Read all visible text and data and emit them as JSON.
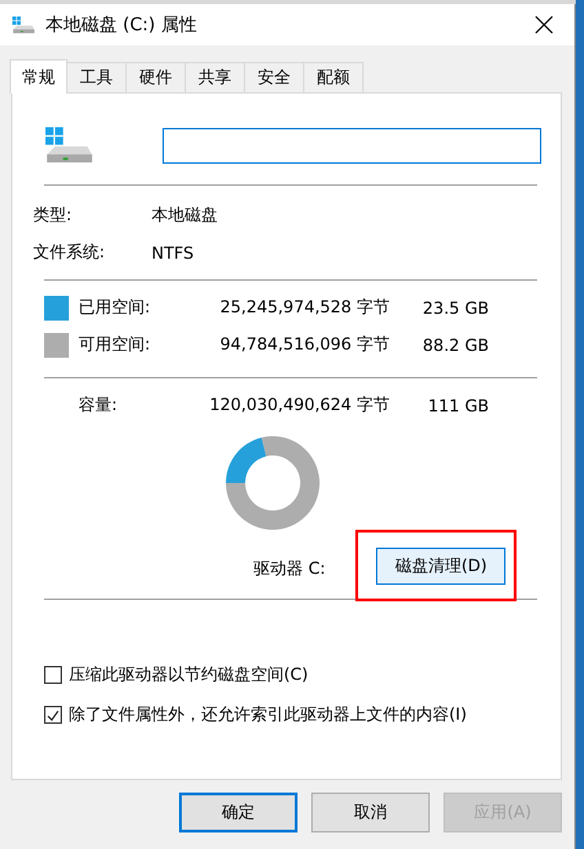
{
  "window": {
    "title": "本地磁盘 (C:) 属性"
  },
  "tabs": [
    {
      "label": "常规",
      "selected": true
    },
    {
      "label": "工具",
      "selected": false
    },
    {
      "label": "硬件",
      "selected": false
    },
    {
      "label": "共享",
      "selected": false
    },
    {
      "label": "安全",
      "selected": false
    },
    {
      "label": "配额",
      "selected": false
    }
  ],
  "name_field": {
    "focused": true
  },
  "info": [
    {
      "label": "类型:",
      "value": "本地磁盘"
    },
    {
      "label": "文件系统:",
      "value": "NTFS"
    }
  ],
  "space": [
    {
      "label": "已用空间:",
      "bytes": "25,245,974,528 字节",
      "size": "23.5 GB",
      "color": "#26a0da"
    },
    {
      "label": "可用空间:",
      "bytes": "94,784,516,096 字节",
      "size": "88.2 GB",
      "color": "#adadad"
    }
  ],
  "capacity": {
    "label": "容量:",
    "bytes": "120,030,490,624 字节",
    "size": "111 GB"
  },
  "usage_chart": {
    "chart_data": {
      "type": "donut",
      "values": [
        21.2,
        78.8
      ]
    }
  },
  "drive_label": "驱动器 C:",
  "cleanup_button": {
    "label": "磁盘清理(D)",
    "highlighted": true
  },
  "options": [
    {
      "label": "压缩此驱动器以节约磁盘空间(C)",
      "checked": false
    },
    {
      "label": "除了文件属性外，还允许索引此驱动器上文件的内容(I)",
      "checked": true
    }
  ],
  "buttons": [
    {
      "label": "确定",
      "kind": "default",
      "disabled": false
    },
    {
      "label": "取消",
      "kind": "normal",
      "disabled": false
    },
    {
      "label": "应用(A)",
      "kind": "normal",
      "disabled": true
    }
  ]
}
